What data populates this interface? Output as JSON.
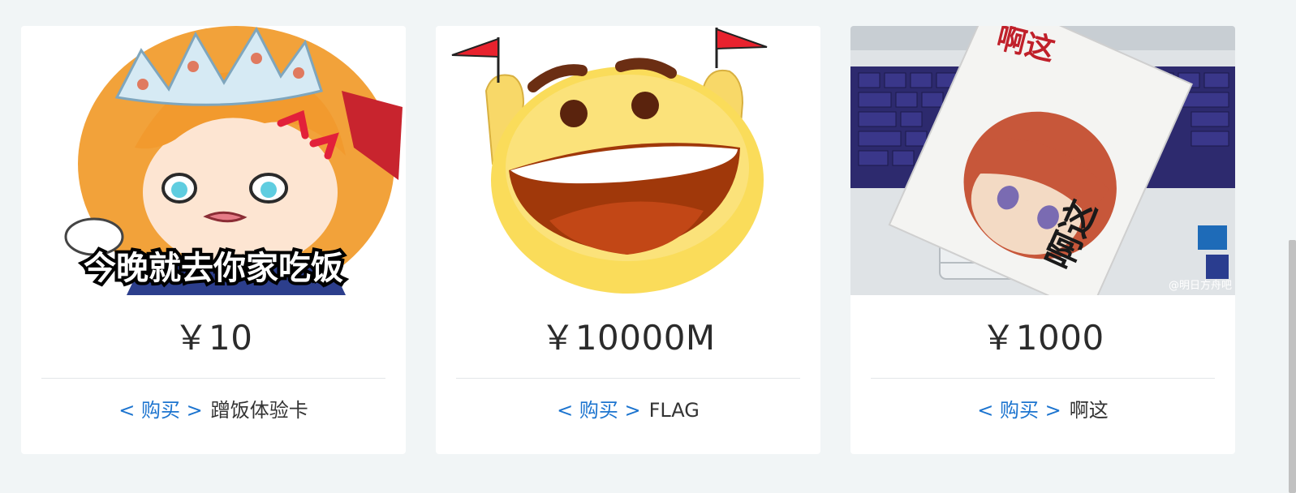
{
  "products": [
    {
      "image_caption": "今晚就去你家吃饭",
      "price": "￥10",
      "buy_label": "< 购买 >",
      "name": "蹭饭体验卡"
    },
    {
      "price": "￥10000M",
      "buy_label": "< 购买 >",
      "name": "FLAG"
    },
    {
      "image_sign_title": "啊这",
      "image_sign_big": "啊这",
      "image_watermark": "@明日方舟吧",
      "price": "￥1000",
      "buy_label": "< 购买 >",
      "name": "啊这"
    }
  ],
  "colors": {
    "page_background": "#f1f5f6",
    "card_background": "#ffffff",
    "link": "#1c74cf",
    "text": "#333333"
  }
}
